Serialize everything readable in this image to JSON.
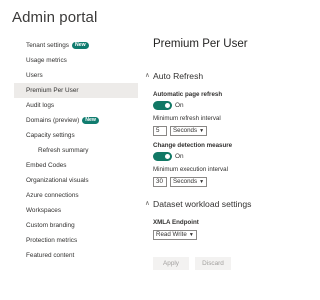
{
  "app": {
    "title": "Admin portal"
  },
  "sidebar": {
    "items": [
      {
        "label": "Tenant settings",
        "badge": "New"
      },
      {
        "label": "Usage metrics"
      },
      {
        "label": "Users"
      },
      {
        "label": "Premium Per User",
        "active": true
      },
      {
        "label": "Audit logs"
      },
      {
        "label": "Domains (preview)",
        "badge": "New"
      },
      {
        "label": "Capacity settings"
      },
      {
        "label": "Refresh summary",
        "sub": true
      },
      {
        "label": "Embed Codes"
      },
      {
        "label": "Organizational visuals"
      },
      {
        "label": "Azure connections"
      },
      {
        "label": "Workspaces"
      },
      {
        "label": "Custom branding"
      },
      {
        "label": "Protection metrics"
      },
      {
        "label": "Featured content"
      }
    ]
  },
  "main": {
    "title": "Premium Per User",
    "auto_refresh": {
      "header": "Auto Refresh",
      "page_refresh_label": "Automatic page refresh",
      "page_refresh_toggle": "On",
      "min_refresh_label": "Minimum refresh interval",
      "min_refresh_value": "5",
      "min_refresh_unit": "Seconds",
      "change_detection_label": "Change detection measure",
      "change_detection_toggle": "On",
      "min_exec_label": "Minimum execution interval",
      "min_exec_value": "30",
      "min_exec_unit": "Seconds"
    },
    "dataset_workload": {
      "header": "Dataset workload settings",
      "xmla_label": "XMLA Endpoint",
      "xmla_value": "Read Write"
    },
    "buttons": {
      "apply": "Apply",
      "discard": "Discard"
    }
  },
  "colors": {
    "accent": "#117865",
    "badge": "#107c6f",
    "active_bg": "#edebe9"
  }
}
